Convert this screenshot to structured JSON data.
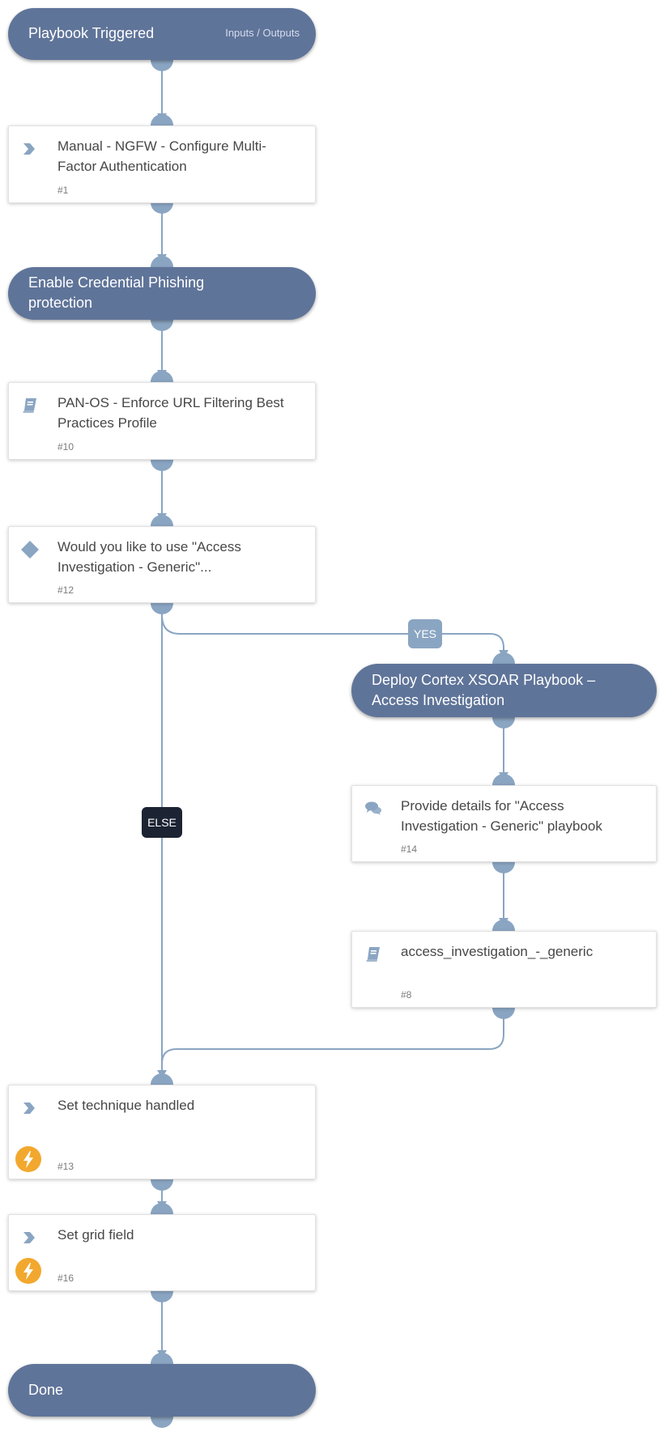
{
  "trigger": {
    "title": "Playbook Triggered",
    "io_link": "Inputs / Outputs"
  },
  "nodes": {
    "n1": {
      "name": "Manual - NGFW - Configure Multi-Factor Authentication",
      "id": "#1",
      "icon": "chevron-right-icon",
      "type": "manual"
    },
    "s1": {
      "title": "Enable Credential Phishing protection"
    },
    "n10": {
      "name": "PAN-OS - Enforce URL Filtering Best Practices Profile",
      "id": "#10",
      "icon": "book-icon",
      "type": "sub-playbook"
    },
    "n12": {
      "name": "Would you like to use \"Access Investigation - Generic\"...",
      "id": "#12",
      "icon": "diamond-icon",
      "type": "condition"
    },
    "s2": {
      "title": "Deploy Cortex XSOAR Playbook – Access Investigation"
    },
    "n14": {
      "name": "Provide details for \"Access Investigation - Generic\" playbook",
      "id": "#14",
      "icon": "chat-icon",
      "type": "communication"
    },
    "n8": {
      "name": "access_investigation_-_generic",
      "id": "#8",
      "icon": "book-icon",
      "type": "sub-playbook"
    },
    "n13": {
      "name": "Set technique handled",
      "id": "#13",
      "icon": "chevron-right-icon",
      "badge": "lightning-icon",
      "type": "automation"
    },
    "n16": {
      "name": "Set grid field",
      "id": "#16",
      "icon": "chevron-right-icon",
      "badge": "lightning-icon",
      "type": "automation"
    },
    "done": {
      "title": "Done"
    }
  },
  "branches": {
    "yes": "YES",
    "else": "ELSE"
  },
  "colors": {
    "section": "#5f7499",
    "connector": "#8aa5c2",
    "else_label": "#1c2333",
    "yes_label": "#8aa5c2",
    "automation_badge": "#f2a82e"
  }
}
